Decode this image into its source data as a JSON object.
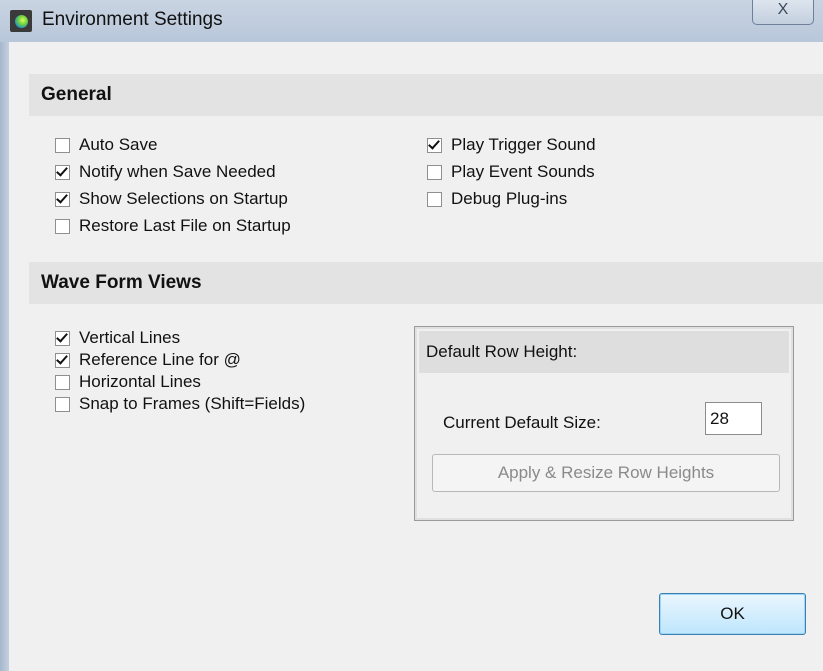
{
  "window": {
    "title": "Environment Settings",
    "close_glyph": "X",
    "icon": "app-logo-icon"
  },
  "general": {
    "header": "General",
    "left_options": [
      {
        "label": "Auto Save",
        "checked": false
      },
      {
        "label": "Notify when Save Needed",
        "checked": true
      },
      {
        "label": "Show Selections on Startup",
        "checked": true
      },
      {
        "label": "Restore Last File on Startup",
        "checked": false
      }
    ],
    "right_options": [
      {
        "label": "Play Trigger Sound",
        "checked": true
      },
      {
        "label": "Play Event Sounds",
        "checked": false
      },
      {
        "label": "Debug Plug-ins",
        "checked": false
      }
    ]
  },
  "waveform": {
    "header": "Wave Form Views",
    "options": [
      {
        "label": "Vertical Lines",
        "checked": true
      },
      {
        "label": "Reference Line for @",
        "checked": true
      },
      {
        "label": "Horizontal Lines",
        "checked": false
      },
      {
        "label": "Snap to Frames (Shift=Fields)",
        "checked": false
      }
    ],
    "row_height": {
      "header": "Default Row Height:",
      "current_label": "Current Default Size:",
      "value": "28",
      "apply_label": "Apply & Resize Row Heights"
    }
  },
  "footer": {
    "ok_label": "OK"
  },
  "colors": {
    "titlebar": "#c9d4e2",
    "section_header": "#e3e3e3",
    "ok_border": "#3c7fb1"
  }
}
